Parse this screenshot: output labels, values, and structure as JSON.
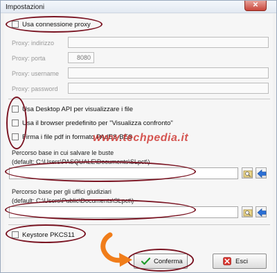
{
  "window": {
    "title": "Impostazioni",
    "close_symbol": "✕"
  },
  "proxy": {
    "checkbox_label": "Usa connessione proxy",
    "checked": false,
    "address_label": "Proxy: indirizzo",
    "address_value": "",
    "port_label": "Proxy: porta",
    "port_value": "8080",
    "username_label": "Proxy: username",
    "username_value": "",
    "password_label": "Proxy: password",
    "password_value": ""
  },
  "options": {
    "desktop_api_label": "Usa Desktop API per visualizzare i file",
    "browser_label": "Usa il browser predefinito per \"Visualizza confronto\"",
    "sign_pdf_label": "Firma i file pdf in formato PAdES-BES"
  },
  "watermark": "www.techpedia.it",
  "base_path": {
    "label": "Percorso base in cui salvare le buste",
    "default_text": "(default: C:\\Users\\PASQUALE\\Documents\\SLpct\\)",
    "value": ""
  },
  "offices_path": {
    "label": "Percorso base per gli uffici giudiziari",
    "default_text": "(default: C:\\Users\\Public\\Documents\\SLpct\\)",
    "value": ""
  },
  "keystore": {
    "label": "Keystore PKCS11",
    "checked": false
  },
  "buttons": {
    "confirm_label": "Conferma",
    "exit_label": "Esci"
  },
  "icons": {
    "browse": "folder-search-icon",
    "back": "blue-left-arrow-icon",
    "confirm": "green-check-icon",
    "exit": "red-x-icon",
    "annotation": "orange-arrow-icon"
  },
  "colors": {
    "annotation_ellipse": "#7a1422",
    "annotation_arrow": "#f07d1a",
    "watermark": "#cd2d28",
    "accent_blue": "#2a6fd6"
  }
}
